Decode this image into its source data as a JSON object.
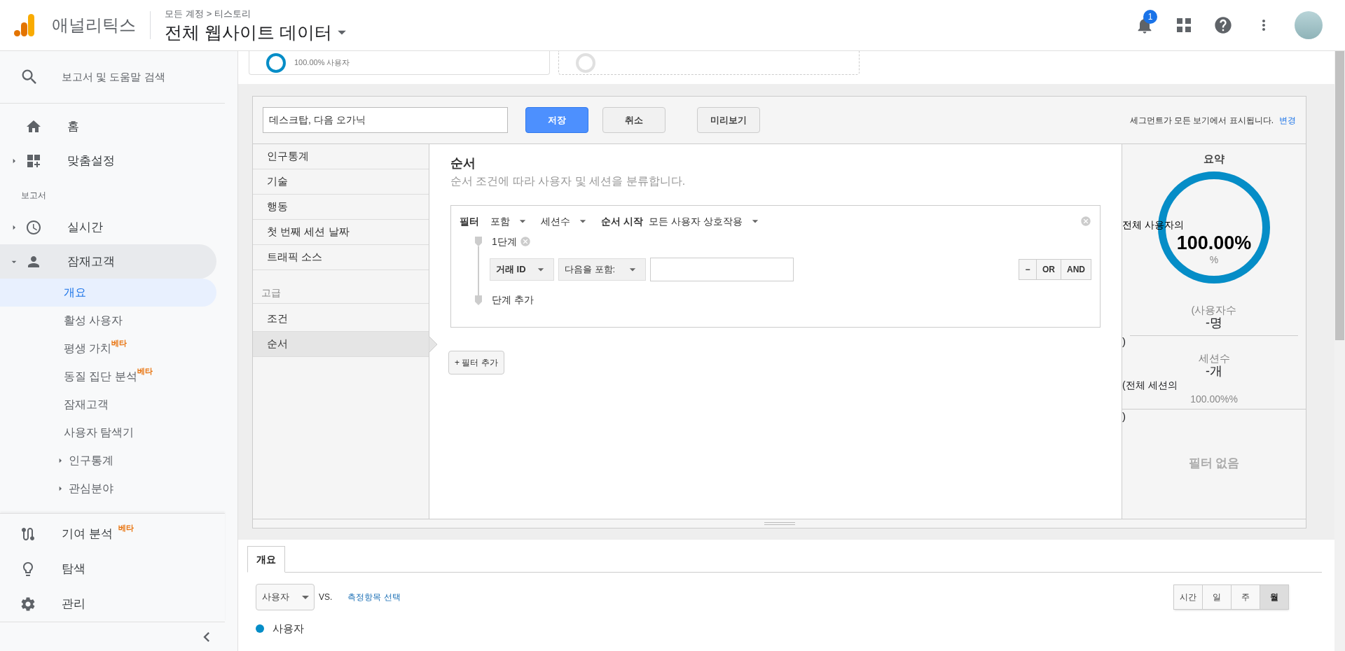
{
  "header": {
    "app_name": "애널리틱스",
    "breadcrumb": [
      "모든 계정",
      "티스토리"
    ],
    "breadcrumb_separator": ">",
    "view_name": "전체 웹사이트 데이터",
    "notification_count": "1"
  },
  "sidebar": {
    "search_label": "보고서 및 도움말 검색",
    "top_items": [
      {
        "label": "홈",
        "kind": "link"
      },
      {
        "label": "맞춤설정",
        "kind": "group",
        "expanded": false
      }
    ],
    "section_label": "보고서",
    "report_items": [
      {
        "label": "실시간",
        "kind": "group",
        "expanded": false
      },
      {
        "label": "잠재고객",
        "kind": "group",
        "expanded": true
      }
    ],
    "children": [
      {
        "label": "개요",
        "kind": "link",
        "selected": true
      },
      {
        "label": "활성 사용자",
        "kind": "link",
        "selected": false
      },
      {
        "label": "평생 가치",
        "badge": "베타",
        "kind": "link",
        "selected": false
      },
      {
        "label": "동질 집단 분석",
        "badge": "베타",
        "kind": "link",
        "selected": false
      },
      {
        "label": "잠재고객",
        "kind": "link",
        "selected": false
      },
      {
        "label": "사용자 탐색기",
        "kind": "link",
        "selected": false
      },
      {
        "label": "인구통계",
        "kind": "group",
        "expanded": false,
        "selected": false
      },
      {
        "label": "관심분야",
        "kind": "group",
        "expanded": false,
        "selected": false
      }
    ],
    "bottom_items": [
      {
        "label": "기여 분석",
        "badge": "베타"
      },
      {
        "label": "탐색"
      },
      {
        "label": "관리"
      }
    ]
  },
  "segment_cards": [
    {
      "text": "100.00% 사용자"
    }
  ],
  "segment_editor": {
    "name_value": "데스크탑, 다음 오가닉",
    "buttons": [
      "저장",
      "취소",
      "미리보기"
    ],
    "notice": "세그먼트가 모든 보기에서 표시됩니다.",
    "notice_link": "변경",
    "categories": [
      {
        "label": "인구통계",
        "selected": false
      },
      {
        "label": "기술",
        "selected": false
      },
      {
        "label": "행동",
        "selected": false
      },
      {
        "label": "첫 번째 세션 날짜",
        "selected": false
      },
      {
        "label": "트래픽 소스",
        "selected": false
      }
    ],
    "advanced_label": "고급",
    "advanced_categories": [
      {
        "label": "조건",
        "selected": false
      },
      {
        "label": "순서",
        "selected": true
      }
    ],
    "title": "순서",
    "subtitle": "순서 조건에 따라 사용자 및 세션을 분류합니다.",
    "filter": {
      "label": "필터",
      "include": "포함",
      "scope": "세션수",
      "start_label": "순서 시작",
      "start_value": "모든 사용자 상호작용",
      "step_label": "1단계",
      "dimension": "거래 ID",
      "operator": "다음을 포함:",
      "logic_buttons": [
        "−",
        "OR",
        "AND"
      ],
      "add_step": "단계 추가"
    },
    "add_filter": "+ 필터 추가",
    "summary": {
      "title": "요약",
      "users_prefix": "전체 사용자의",
      "users_percent": "100.00%",
      "percent_unit": "%",
      "users_label": "(사용자수",
      "users_value": "-명",
      "users_close": ")",
      "sessions_label": "세션수",
      "sessions_value": "-개",
      "sessions_prefix": "(전체 세션의",
      "sessions_percent": "100.00%%",
      "sessions_close": ")",
      "no_filter": "필터 없음"
    }
  },
  "report": {
    "tabs": [
      {
        "label": "개요",
        "selected": true
      }
    ],
    "metric": "사용자",
    "vs": "VS.",
    "metric_link": "측정항목 선택",
    "periods": [
      {
        "label": "시간",
        "selected": false
      },
      {
        "label": "일",
        "selected": false
      },
      {
        "label": "주",
        "selected": false
      },
      {
        "label": "월",
        "selected": true
      }
    ],
    "legend": [
      {
        "label": "사용자",
        "color": "#058dc7"
      }
    ]
  }
}
